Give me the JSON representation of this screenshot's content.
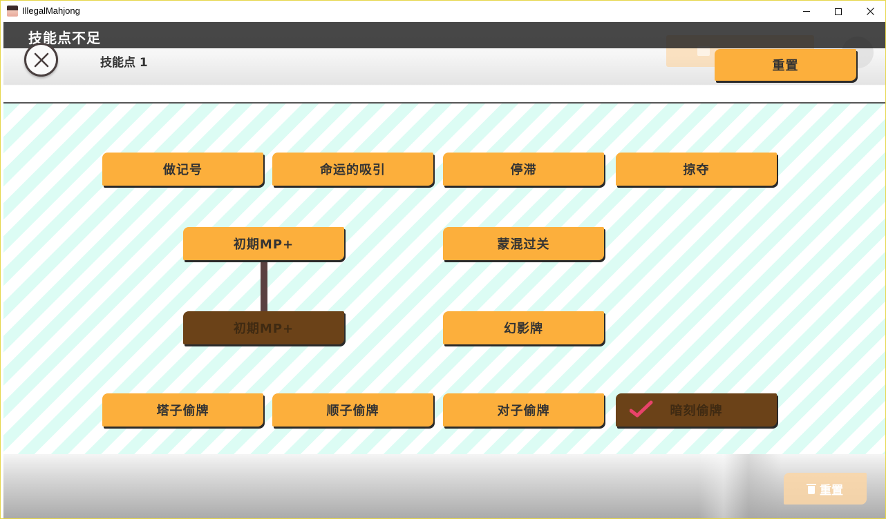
{
  "window": {
    "title": "IllegalMahjong",
    "controls": {
      "minimize": "minimize-icon",
      "maximize": "maximize-icon",
      "close": "close-icon"
    }
  },
  "header": {
    "toast": "技能点不足",
    "skill_points_label": "技能点 1",
    "reset_label": "重置"
  },
  "skills": {
    "row1": [
      "做记号",
      "命运的吸引",
      "停滞",
      "掠夺"
    ],
    "mp_plus_1": "初期MP+",
    "mp_plus_2": "初期MP+",
    "bluff": "蒙混过关",
    "phantom": "幻影牌",
    "row4": [
      "塔子偷牌",
      "顺子偷牌",
      "对子偷牌",
      "暗刻偷牌"
    ]
  },
  "footer": {
    "reset_label": "重置"
  },
  "colors": {
    "skill_available": "#fcaf3c",
    "skill_owned": "#6b4218",
    "stripe": "#dcfcf4",
    "check": "#e8436a"
  }
}
